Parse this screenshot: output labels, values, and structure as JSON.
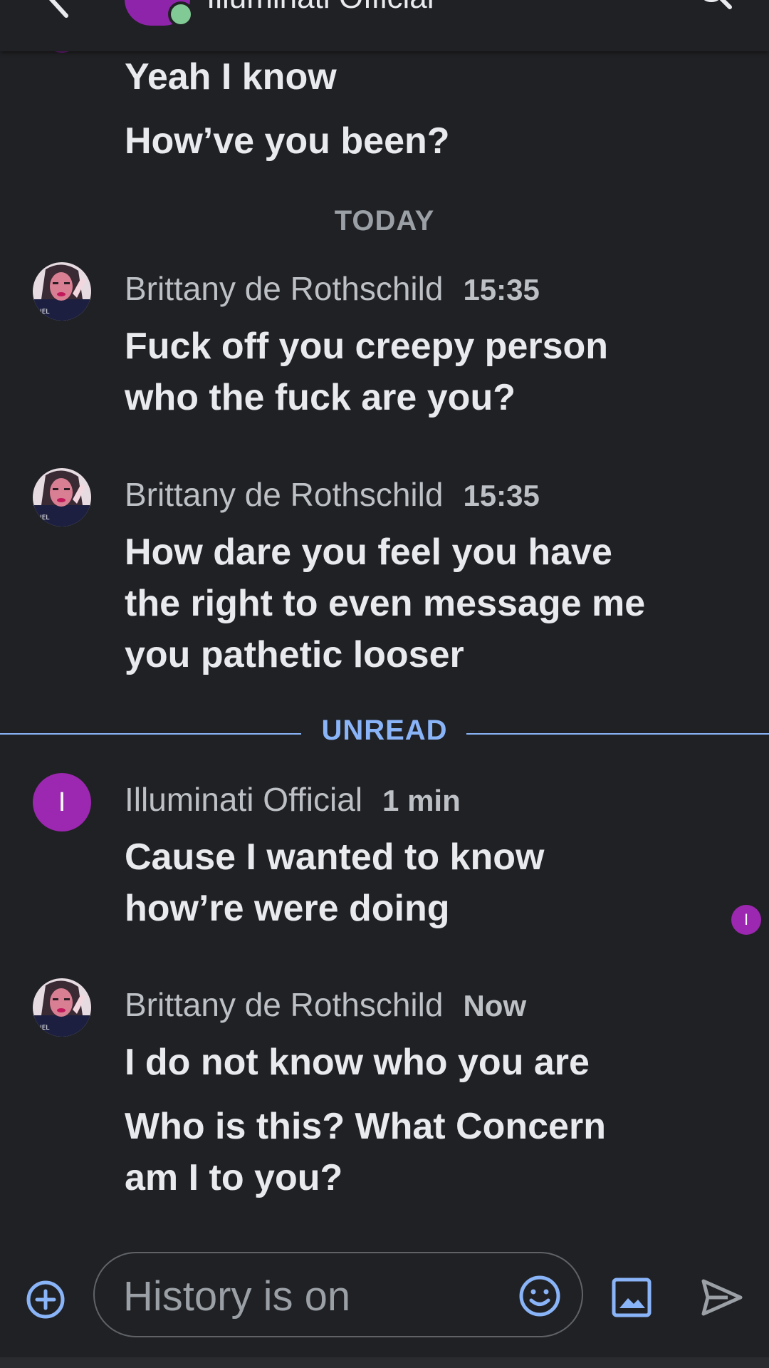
{
  "header": {
    "title": "Illuminati Official",
    "back_icon": "arrow-back-icon",
    "search_icon": "search-icon"
  },
  "messages_top": {
    "line1": "Yeah I know",
    "line2": "How’ve you been?"
  },
  "divider_today": "TODAY",
  "messages": [
    {
      "sender": "Brittany de Rothschild",
      "time": "15:35",
      "lines": [
        "Fuck off you creepy person",
        "who the fuck are you?"
      ]
    },
    {
      "sender": "Brittany de Rothschild",
      "time": "15:35",
      "lines": [
        "How dare you feel you have",
        "the right to even message me",
        "you pathetic looser"
      ]
    },
    {
      "sender": "Illuminati Official",
      "time": "1 min",
      "avatar_letter": "I",
      "lines": [
        "Cause I wanted to know",
        "how’re were doing"
      ]
    },
    {
      "sender": "Brittany de Rothschild",
      "time": "Now",
      "lines": [
        "I do not know who you are",
        "Who is this? What Concern",
        "am I to you?"
      ]
    }
  ],
  "divider_unread": "UNREAD",
  "read_receipt_letter": "I",
  "compose": {
    "placeholder": "History is on",
    "add_icon": "add-circle-icon",
    "emoji_icon": "emoji-icon",
    "image_icon": "image-icon",
    "send_icon": "send-icon"
  },
  "colors": {
    "background": "#202124",
    "accent": "#8ab4f8",
    "avatar_purple": "#9c27b0",
    "presence_green": "#81c995"
  }
}
